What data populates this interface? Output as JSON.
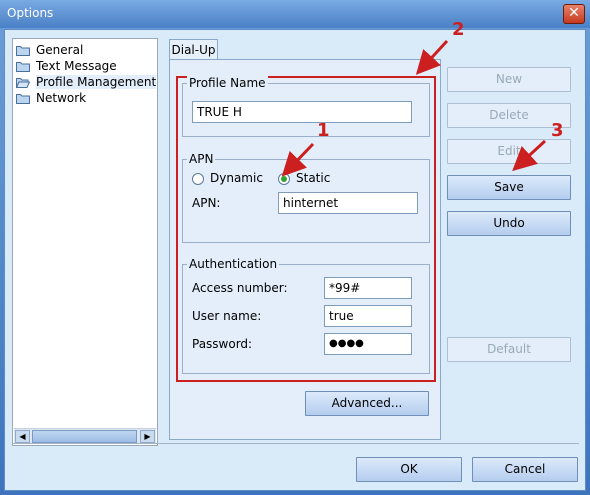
{
  "window": {
    "title": "Options",
    "close_symbol": "✕"
  },
  "tree": {
    "items": [
      {
        "label": "General"
      },
      {
        "label": "Text Message"
      },
      {
        "label": "Profile Management",
        "selected": true
      },
      {
        "label": "Network"
      }
    ],
    "scroll_left": "◀",
    "scroll_right": "▶"
  },
  "tab": {
    "label": "Dial-Up"
  },
  "profile": {
    "group_label": "Profile Name",
    "name_value": "TRUE H"
  },
  "apn": {
    "group_label": "APN",
    "dynamic_label": "Dynamic",
    "static_label": "Static",
    "selected": "Static",
    "apn_label": "APN:",
    "apn_value": "hinternet"
  },
  "auth": {
    "group_label": "Authentication",
    "access_number_label": "Access number:",
    "access_number_value": "*99#",
    "user_name_label": "User name:",
    "user_name_value": "true",
    "password_label": "Password:",
    "password_value": "●●●●"
  },
  "buttons": {
    "advanced": "Advanced...",
    "new": "New",
    "delete": "Delete",
    "edit": "Edit",
    "save": "Save",
    "undo": "Undo",
    "default": "Default",
    "ok": "OK",
    "cancel": "Cancel"
  },
  "annotations": {
    "one": "1",
    "two": "2",
    "three": "3"
  },
  "colors": {
    "annotation": "#cc1f1f",
    "radio_checked": "#2fa52f"
  }
}
